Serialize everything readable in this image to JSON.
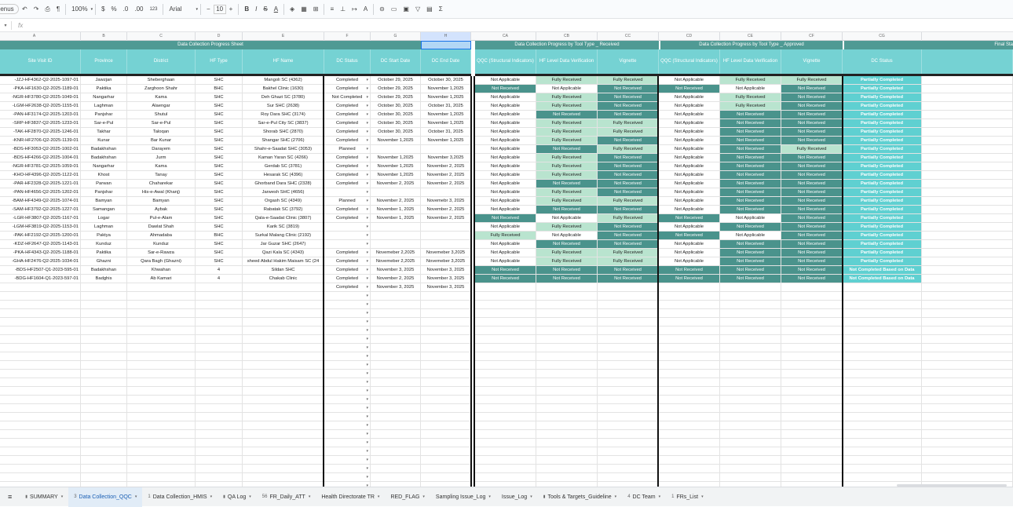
{
  "toolbar": {
    "menu_stub": "enus",
    "zoom": "100%",
    "currency": "$",
    "percent": "%",
    "dec_less": ".0",
    "dec_more": ".00",
    "format_123": "123",
    "font": "Arial",
    "font_size": "10",
    "minus": "−",
    "plus": "+",
    "bold": "B",
    "italic": "I",
    "strike": "S",
    "underline_a": "A",
    "sigma": "Σ"
  },
  "formula_bar": {
    "fx": "fx",
    "cell_ref": ""
  },
  "columns": {
    "A": "A",
    "B": "B",
    "C": "C",
    "D": "D",
    "E": "E",
    "F": "F",
    "G": "G",
    "H": "H",
    "CA": "CA",
    "CB": "CB",
    "CC": "CC",
    "CD": "CD",
    "CE": "CE",
    "CF": "CF",
    "CG": "CG"
  },
  "section_headers": {
    "progress_sheet": "Data Collection Progress Sheet",
    "received": "Data Collection Progress by Tool Type _ Received",
    "approved": "Data Collection Progress by Tool Type _ Approved",
    "final": "Final Sta"
  },
  "headers": {
    "site_visit_id": "Site Visit ID",
    "province": "Province",
    "district": "District",
    "hf_type": "HF Type",
    "hf_name": "HF Name",
    "dc_status": "DC Status",
    "dc_start": "DC Start Date",
    "dc_end": "DC End Date",
    "qqc": "QQC (Structural Indicators)",
    "hf_level": "HF Level Data Verification",
    "vignette": "Vignette",
    "qqc2": "QQC (Structural Indicators)",
    "hf_level2": "HF Level Data Verification",
    "vignette2": "Vignette",
    "final_dc_status": "DC Status"
  },
  "rows": [
    {
      "id": "-JZJ-HF4362-Q2-2025-1097-01",
      "prov": "Jawzjan",
      "dist": "Sheberghaan",
      "type": "SHC",
      "name": "Mangoli SC (4362)",
      "status": "Completed",
      "start": "October 29, 2025",
      "end": "October 30, 2025",
      "r": [
        "na",
        "fr",
        "fr"
      ],
      "a": [
        "na",
        "fr",
        "fr"
      ],
      "f": "Partially Completed"
    },
    {
      "id": "-PKA-HF1630-Q2-2025-1189-01",
      "prov": "Paktika",
      "dist": "Zarghoon Shahr",
      "type": "BHC",
      "name": "Bakhel Clinic (1630)",
      "status": "Completed",
      "start": "October 29, 2025",
      "end": "November 1,2025",
      "r": [
        "nr",
        "na",
        "nr"
      ],
      "a": [
        "nr",
        "na",
        "nr"
      ],
      "f": "Partially Completed"
    },
    {
      "id": "-NGR-HF3780-Q2-2025-1049-01",
      "prov": "Nangarhar",
      "dist": "Kama",
      "type": "SHC",
      "name": "Deh Ghazi SC (3780)",
      "status": "Not Completed",
      "start": "October 29, 2025",
      "end": "November 1,2025",
      "r": [
        "na",
        "fr",
        "nr"
      ],
      "a": [
        "na",
        "fr",
        "nr"
      ],
      "f": "Partially Completed"
    },
    {
      "id": "-LGM-HF2638-Q2-2025-1155-01",
      "prov": "Laghman",
      "dist": "Alaengar",
      "type": "SHC",
      "name": "Sur SHC (2638)",
      "status": "Completed",
      "start": "October 30, 2025",
      "end": "October 31, 2025",
      "r": [
        "na",
        "fr",
        "nr"
      ],
      "a": [
        "na",
        "fr",
        "nr"
      ],
      "f": "Partially Completed"
    },
    {
      "id": "-PAN-HF3174-Q2-2025-1203-01",
      "prov": "Panjshar",
      "dist": "Shutul",
      "type": "SHC",
      "name": "Roy Dara SHC (3174)",
      "status": "Completed",
      "start": "October 30, 2025",
      "end": "November 1,2025",
      "r": [
        "na",
        "nr",
        "nr"
      ],
      "a": [
        "na",
        "nr",
        "nr"
      ],
      "f": "Partially Completed"
    },
    {
      "id": "-SRP-HF3837-Q2-2025-1233-01",
      "prov": "Sar-e-Pul",
      "dist": "Sar-e-Pul",
      "type": "SHC",
      "name": "Sar-e-Pul City SC (3837)",
      "status": "Completed",
      "start": "October 30, 2025",
      "end": "November 1,2025",
      "r": [
        "na",
        "fr",
        "fr"
      ],
      "a": [
        "na",
        "nr",
        "nr"
      ],
      "f": "Partially Completed"
    },
    {
      "id": "-TAK-HF2870-Q2-2025-1246-01",
      "prov": "Takhar",
      "dist": "Taloqan",
      "type": "SHC",
      "name": "Shorab SHC (2870)",
      "status": "Completed",
      "start": "October 30, 2025",
      "end": "October 31, 2025",
      "r": [
        "na",
        "fr",
        "fr"
      ],
      "a": [
        "na",
        "nr",
        "nr"
      ],
      "f": "Partially Completed"
    },
    {
      "id": "-KNR-HF2706-Q2-2025-1139-01",
      "prov": "Kunar",
      "dist": "Bar Kunar",
      "type": "SHC",
      "name": "Shangar SHC (2706)",
      "status": "Completed",
      "start": "November 1,2025",
      "end": "November 1,2025",
      "r": [
        "na",
        "fr",
        "nr"
      ],
      "a": [
        "na",
        "nr",
        "nr"
      ],
      "f": "Partially Completed"
    },
    {
      "id": "-BDS-HF3053-Q2-2025-1002-01",
      "prov": "Badakhshan",
      "dist": "Darayem",
      "type": "SHC",
      "name": "Shahr-e-Saadat SHC (3053)",
      "status": "Planned",
      "start": "",
      "end": "",
      "r": [
        "na",
        "nr",
        "fr"
      ],
      "a": [
        "na",
        "nr",
        "fr"
      ],
      "f": "Partially Completed"
    },
    {
      "id": "-BDS-HF4266-Q2-2025-1004-01",
      "prov": "Badakhshan",
      "dist": "Jurm",
      "type": "SHC",
      "name": "Kaman Yaran SC (4266)",
      "status": "Completed",
      "start": "November 1,2025",
      "end": "November 3,2025",
      "r": [
        "na",
        "fr",
        "nr"
      ],
      "a": [
        "na",
        "nr",
        "nr"
      ],
      "f": "Partially Completed"
    },
    {
      "id": "-NGR-HF3781-Q2-2025-1059-01",
      "prov": "Nangarhar",
      "dist": "Kama",
      "type": "SHC",
      "name": "Gerdab SC (3781)",
      "status": "Completed",
      "start": "November 1,2025",
      "end": "November 2, 2025",
      "r": [
        "na",
        "fr",
        "nr"
      ],
      "a": [
        "na",
        "nr",
        "nr"
      ],
      "f": "Partially Completed"
    },
    {
      "id": "-KHO-HF4396-Q2-2025-1122-01",
      "prov": "Khost",
      "dist": "Tanay",
      "type": "SHC",
      "name": "Hesarak SC (4396)",
      "status": "Completed",
      "start": "November 1,2025",
      "end": "November 2, 2025",
      "r": [
        "na",
        "fr",
        "nr"
      ],
      "a": [
        "na",
        "nr",
        "nr"
      ],
      "f": "Partially Completed"
    },
    {
      "id": "-PAR-HF2328-Q2-2025-1221-01",
      "prov": "Parwan",
      "dist": "Chaharekar",
      "type": "SHC",
      "name": "Ghorband Dara SHC (2328)",
      "status": "Completed",
      "start": "November 2, 2025",
      "end": "November 2, 2025",
      "r": [
        "na",
        "nr",
        "nr"
      ],
      "a": [
        "na",
        "nr",
        "nr"
      ],
      "f": "Partially Completed"
    },
    {
      "id": "-PAN-HF4656-Q2-2025-1202-01",
      "prov": "Panjshar",
      "dist": "His-e-Awal (Khanj)",
      "type": "SHC",
      "name": "Jarwesh SHC (4656)",
      "status": "",
      "start": "",
      "end": "",
      "r": [
        "na",
        "fr",
        "nr"
      ],
      "a": [
        "na",
        "nr",
        "nr"
      ],
      "f": "Partially Completed"
    },
    {
      "id": "-BAM-HF4349-Q2-2025-1074-01",
      "prov": "Bamyan",
      "dist": "Bamyan",
      "type": "SHC",
      "name": "Orgash SC (4349)",
      "status": "Planned",
      "start": "November 2, 2025",
      "end": "Novemebr 3, 2025",
      "r": [
        "na",
        "fr",
        "fr"
      ],
      "a": [
        "na",
        "nr",
        "nr"
      ],
      "f": "Partially Completed"
    },
    {
      "id": "-SAM-HF3792-Q2-2025-1227-01",
      "prov": "Samangan",
      "dist": "Aybak",
      "type": "SHC",
      "name": "Rabatak SC (3792)",
      "status": "Completed",
      "start": "November 1, 2025",
      "end": "November 2, 2025",
      "r": [
        "na",
        "nr",
        "nr"
      ],
      "a": [
        "na",
        "nr",
        "nr"
      ],
      "f": "Partially Completed"
    },
    {
      "id": "-LGR-HF3807-Q2-2025-1167-01",
      "prov": "Logar",
      "dist": "Pul-e-Alam",
      "type": "SHC",
      "name": "Qala-e-Saadat Clinic (3807)",
      "status": "Completed",
      "start": "November 1, 2025",
      "end": "November 2, 2025",
      "r": [
        "nr",
        "na",
        "fr"
      ],
      "a": [
        "nr",
        "na",
        "nr"
      ],
      "f": "Partially Completed"
    },
    {
      "id": "-LGM-HF3819-Q2-2025-1153-01",
      "prov": "Laghman",
      "dist": "Dawlat Shah",
      "type": "SHC",
      "name": "Karik SC (3819)",
      "status": "",
      "start": "",
      "end": "",
      "r": [
        "na",
        "fr",
        "nr"
      ],
      "a": [
        "na",
        "nr",
        "nr"
      ],
      "f": "Partially Completed"
    },
    {
      "id": "-PAK-HF2192-Q2-2025-1200-01",
      "prov": "Paktya",
      "dist": "Ahmadaba",
      "type": "BHC",
      "name": "Surkal Malang Clinic (2192)",
      "status": "",
      "start": "",
      "end": "",
      "r": [
        "fr",
        "na",
        "nr"
      ],
      "a": [
        "nr",
        "na",
        "nr"
      ],
      "f": "Partially Completed"
    },
    {
      "id": "-KDZ-HF2647-Q2-2025-1143-01",
      "prov": "Kunduz",
      "dist": "Kunduz",
      "type": "SHC",
      "name": "Jar Guzar SHC (2647)",
      "status": "",
      "start": "",
      "end": "",
      "r": [
        "na",
        "nr",
        "nr"
      ],
      "a": [
        "na",
        "nr",
        "nr"
      ],
      "f": "Partially Completed"
    },
    {
      "id": "-PKA-HF4343-Q2-2025-1188-01",
      "prov": "Paktika",
      "dist": "Sar-e-Rawza",
      "type": "SHC",
      "name": "Qazi Kala SC (4343)",
      "status": "Completed",
      "start": "Novemeber 2,2025",
      "end": "Novemeber 3,2025",
      "r": [
        "na",
        "fr",
        "fr"
      ],
      "a": [
        "na",
        "nr",
        "nr"
      ],
      "f": "Partially Completed"
    },
    {
      "id": "-GHA-HF2476-Q2-2025-1034-01",
      "prov": "Ghazni",
      "dist": "Qara Bagh (Ghazni)",
      "type": "SHC",
      "name": "sheed Abdul Hakim Maisam SC (24",
      "status": "Completed",
      "start": "Novemeber 2,2025",
      "end": "Novemeber 3,2025",
      "r": [
        "na",
        "fr",
        "fr"
      ],
      "a": [
        "na",
        "nr",
        "nr"
      ],
      "f": "Partially Completed"
    },
    {
      "id": "-BDS-HF2507-Q1-2023-595-01",
      "prov": "Badakhshan",
      "dist": "Khwahan",
      "type": "4",
      "name": "Sildan SHC",
      "status": "Completed",
      "start": "November 3, 2025",
      "end": "November 3, 2025",
      "r": [
        "nr",
        "nr",
        "nr"
      ],
      "a": [
        "nr",
        "nr",
        "nr"
      ],
      "f": "Not Completed Based on Data"
    },
    {
      "id": "-BDG-HF1604-Q1-2023-597-01",
      "prov": "Badghis",
      "dist": "Ab Kamari",
      "type": "4",
      "name": "Chakab Clinic",
      "status": "Completed",
      "start": "November 2, 2025",
      "end": "November 3, 2025",
      "r": [
        "nr",
        "nr",
        "nr"
      ],
      "a": [
        "nr",
        "nr",
        "nr"
      ],
      "f": "Not Completed Based on Data"
    },
    {
      "id": "",
      "prov": "",
      "dist": "",
      "type": "",
      "name": "",
      "status": "Completed",
      "start": "November 3, 2025",
      "end": "November 3, 2025",
      "r": [
        "",
        "",
        ""
      ],
      "a": [
        "",
        "",
        ""
      ],
      "f": ""
    }
  ],
  "status_labels": {
    "na": "Not Applicable",
    "nr": "Not Received",
    "fr": "Fully Received"
  },
  "tabs": [
    {
      "label": "SUMMARY",
      "icon": "lock",
      "active": false
    },
    {
      "label": "Data Collection_QQC",
      "icon": "3",
      "active": true
    },
    {
      "label": "Data Collection_HMIS",
      "icon": "1",
      "active": false
    },
    {
      "label": "QA Log",
      "icon": "lock",
      "active": false
    },
    {
      "label": "FR_Daily_ATT",
      "icon": "56",
      "active": false
    },
    {
      "label": "Health Directorate TR",
      "icon": "",
      "active": false
    },
    {
      "label": "RED_FLAG",
      "icon": "",
      "active": false
    },
    {
      "label": "Sampling Issue_Log",
      "icon": "",
      "active": false
    },
    {
      "label": "Issue_Log",
      "icon": "",
      "active": false
    },
    {
      "label": "Tools & Targets_Guideline",
      "icon": "lock",
      "active": false
    },
    {
      "label": "DC Team",
      "icon": "4",
      "active": false
    },
    {
      "label": "FRs_List",
      "icon": "1",
      "active": false
    }
  ]
}
